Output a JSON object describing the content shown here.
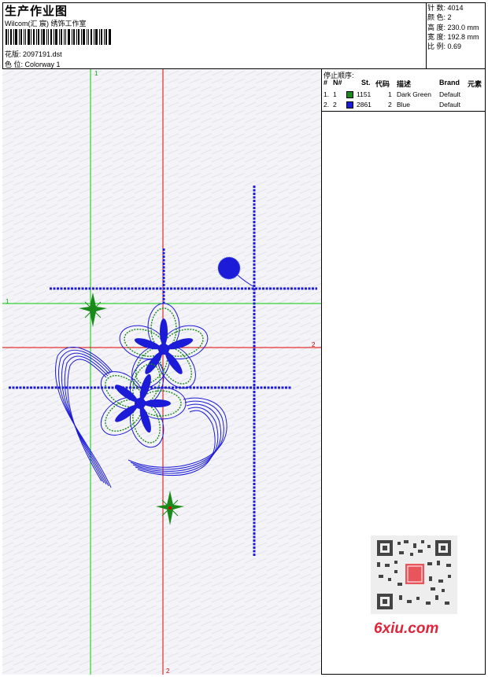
{
  "header": {
    "title": "生产作业图",
    "studio": "Wilcom(汇 宸) 绣饰工作室",
    "design_label": "花版:",
    "design_value": "2097191.dst",
    "colorway_label": "色 位:",
    "colorway_value": "Colorway 1"
  },
  "stats": [
    {
      "label": "针 数:",
      "value": "4014"
    },
    {
      "label": "颜 色:",
      "value": "2"
    },
    {
      "label": "高 度:",
      "value": "230.0 mm"
    },
    {
      "label": "宽 度:",
      "value": "192.8 mm"
    },
    {
      "label": "比 例:",
      "value": "0.69"
    }
  ],
  "stop_sequence": {
    "title": "停止顺序:",
    "headers": [
      "#",
      "N#",
      "St.",
      "代码",
      "描述",
      "Brand",
      "元素"
    ],
    "rows": [
      {
        "index": "1.",
        "needle": "1",
        "stitches": "1151",
        "code": "1",
        "description": "Dark Green",
        "brand": "Default",
        "color": "#1a8a1a"
      },
      {
        "index": "2.",
        "needle": "2",
        "stitches": "2861",
        "code": "2",
        "description": "Blue",
        "brand": "Default",
        "color": "#1c1cd8"
      }
    ]
  },
  "guides": {
    "green_vertical_label": "1",
    "green_horizontal_label": "1",
    "red_vertical_label": "2",
    "red_horizontal_label": "2"
  },
  "watermark": {
    "text": "6xiu.com"
  },
  "colors": {
    "green_guide": "#00cc00",
    "red_guide": "#e00000",
    "thread_blue": "#1c1cd8",
    "thread_green": "#1a8a1a"
  }
}
